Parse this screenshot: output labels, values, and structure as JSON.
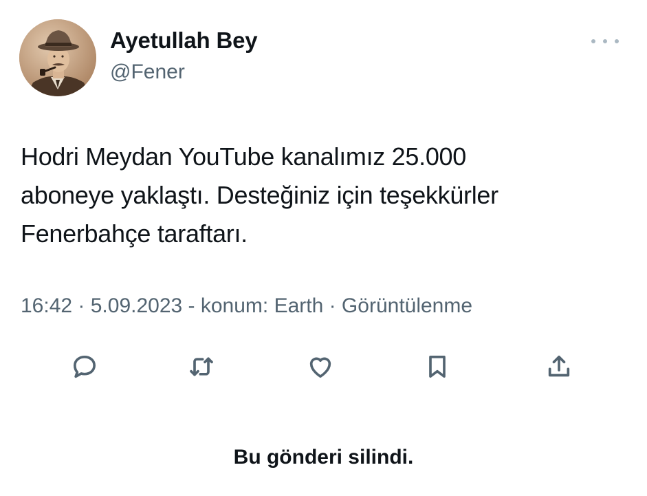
{
  "author": {
    "display_name": "Ayetullah Bey",
    "handle": "@Fener",
    "avatar_icon": "vintage-portrait-man-with-pipe"
  },
  "tweet": {
    "text_lines": [
      "Hodri Meydan YouTube kanalımız 25.000",
      "aboneye yaklaştı. Desteğiniz için teşekkürler",
      "Fenerbahçe taraftarı."
    ],
    "meta": "16:42 · 5.09.2023 - konum: Earth · Görüntülenme"
  },
  "actions": [
    {
      "name": "reply",
      "icon": "speech-bubble-icon"
    },
    {
      "name": "retweet",
      "icon": "retweet-icon"
    },
    {
      "name": "like",
      "icon": "heart-icon"
    },
    {
      "name": "bookmark",
      "icon": "bookmark-icon"
    },
    {
      "name": "share",
      "icon": "share-icon"
    }
  ],
  "footer": {
    "notice": "Bu gönderi silindi."
  },
  "colors": {
    "text": "#0f1419",
    "secondary": "#536471",
    "more_dots": "#aab8c2",
    "background": "#ffffff"
  }
}
